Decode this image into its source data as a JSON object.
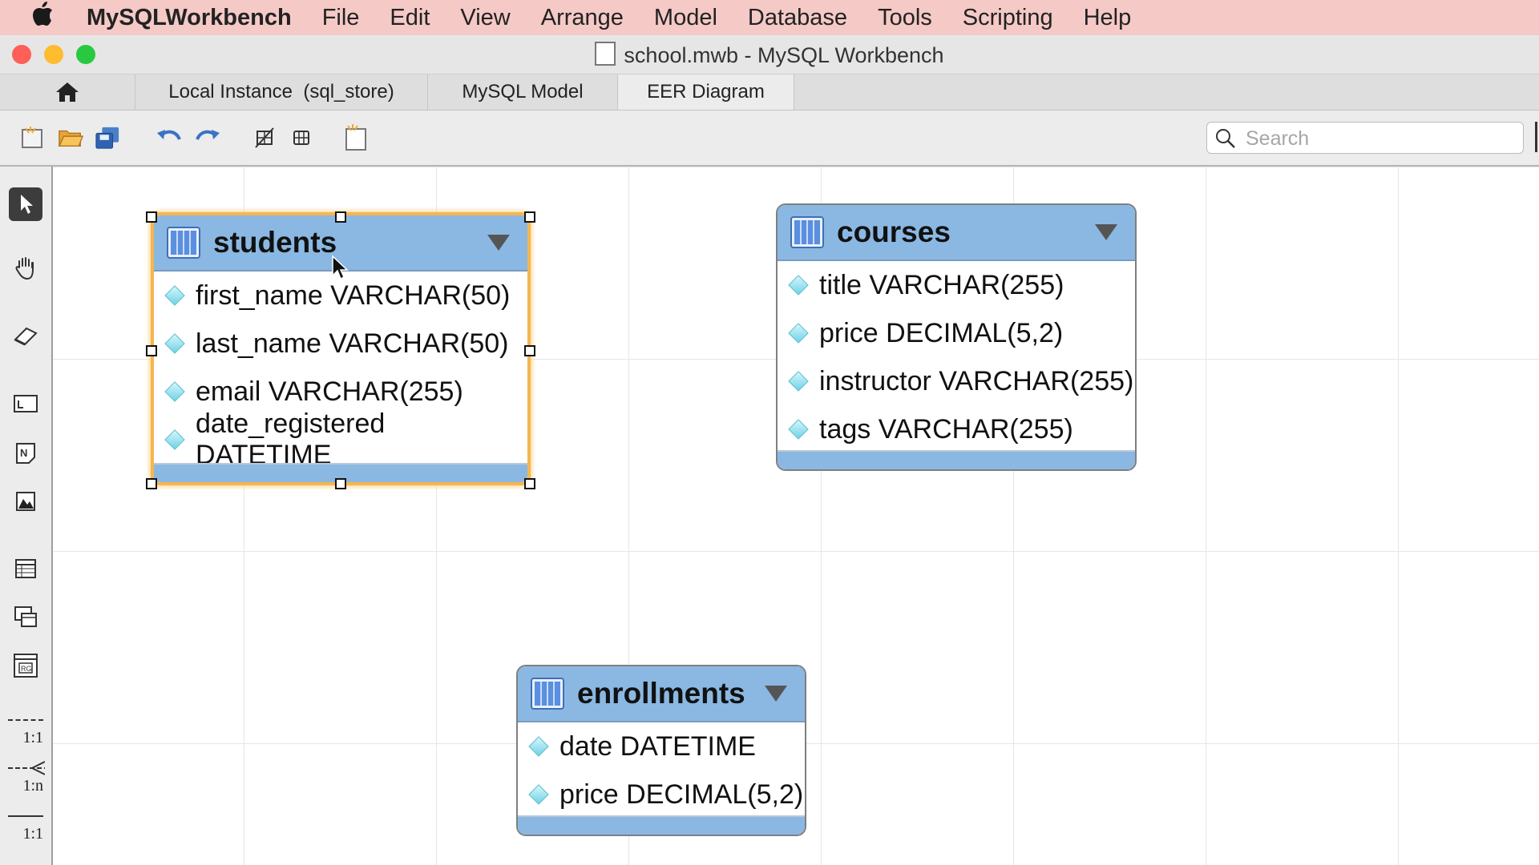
{
  "menubar": {
    "app_name": "MySQLWorkbench",
    "items": [
      "File",
      "Edit",
      "View",
      "Arrange",
      "Model",
      "Database",
      "Tools",
      "Scripting",
      "Help"
    ]
  },
  "window": {
    "title": "school.mwb - MySQL Workbench"
  },
  "tabs": [
    {
      "label": "Local Instance  (sql_store)",
      "active": false
    },
    {
      "label": "MySQL Model",
      "active": false
    },
    {
      "label": "EER Diagram",
      "active": true
    }
  ],
  "search": {
    "placeholder": "Search",
    "value": ""
  },
  "palette": {
    "relationships": [
      "1:1",
      "1:n",
      "1:1"
    ]
  },
  "diagram": {
    "tables": [
      {
        "name": "students",
        "selected": true,
        "columns": [
          "first_name VARCHAR(50)",
          "last_name VARCHAR(50)",
          "email VARCHAR(255)",
          "date_registered DATETIME"
        ]
      },
      {
        "name": "courses",
        "selected": false,
        "columns": [
          "title VARCHAR(255)",
          "price DECIMAL(5,2)",
          "instructor VARCHAR(255)",
          "tags VARCHAR(255)"
        ]
      },
      {
        "name": "enrollments",
        "selected": false,
        "columns": [
          "date DATETIME",
          "price DECIMAL(5,2)"
        ]
      }
    ]
  },
  "colors": {
    "table_header": "#8ab8e3",
    "selection": "#f6b64d",
    "menubar": "#f4c9c6"
  }
}
